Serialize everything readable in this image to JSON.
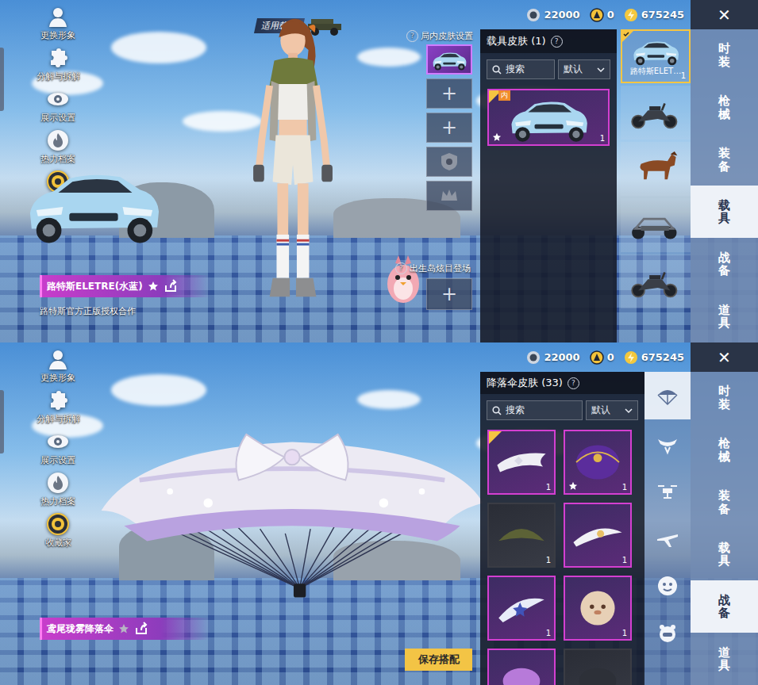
{
  "vehicle_screen": {
    "left_menu": [
      {
        "label": "更换形象"
      },
      {
        "label": "分解与拆解"
      },
      {
        "label": "展示设置"
      },
      {
        "label": "热力档案"
      },
      {
        "label": "藏家"
      }
    ],
    "applicable_vehicle": {
      "label": "适用载具"
    },
    "currency": [
      {
        "value": "22000"
      },
      {
        "value": "0"
      },
      {
        "value": "675245"
      }
    ],
    "close": "✕",
    "featured": {
      "name": "路特斯ELETRE(水蓝)",
      "subtitle": "路特斯官方正版授权合作"
    },
    "skin_slots": {
      "title": "局内皮肤设置",
      "help": "?",
      "slots": [
        {
          "kind": "car",
          "selected": true
        },
        {
          "kind": "add",
          "label": "+",
          "selected": false
        },
        {
          "kind": "add",
          "label": "+",
          "selected": false
        },
        {
          "kind": "badge",
          "selected": false
        },
        {
          "kind": "crown",
          "selected": false
        }
      ]
    },
    "entrance": {
      "title": "出生岛炫目登场",
      "help": "?",
      "add": "+"
    },
    "panel": {
      "title": "载具皮肤 (1)",
      "help": "?",
      "search": "搜索",
      "sort": "默认",
      "items": [
        {
          "tag": "内",
          "count": "1",
          "starred": true,
          "equipped": true
        }
      ]
    },
    "vehicles": [
      {
        "kind": "car",
        "label": "路特斯ELET…",
        "count": "1",
        "selected": true
      },
      {
        "kind": "motorcycle",
        "selected": false
      },
      {
        "kind": "horse",
        "selected": false
      },
      {
        "kind": "buggy",
        "selected": false
      },
      {
        "kind": "motorcycle",
        "selected": false
      }
    ],
    "tabs": [
      {
        "label": "时装",
        "selected": false
      },
      {
        "label": "枪械",
        "selected": false
      },
      {
        "label": "装备",
        "selected": false
      },
      {
        "label": "载具",
        "selected": true
      },
      {
        "label": "战备",
        "selected": false
      },
      {
        "label": "道具",
        "selected": false
      }
    ]
  },
  "parachute_screen": {
    "left_menu": [
      {
        "label": "更换形象"
      },
      {
        "label": "分解与拆解"
      },
      {
        "label": "展示设置"
      },
      {
        "label": "热力档案"
      },
      {
        "label": "收藏家"
      }
    ],
    "currency": [
      {
        "value": "22000"
      },
      {
        "value": "0"
      },
      {
        "value": "675245"
      }
    ],
    "close": "✕",
    "featured": {
      "name": "鸢尾珑雾降落伞"
    },
    "panel": {
      "title": "降落伞皮肤 (33)",
      "help": "?",
      "search": "搜索",
      "sort": "默认",
      "items": [
        {
          "kind": "white-bow",
          "count": "1",
          "starred": false,
          "equipped": true,
          "color": "#d43fd1"
        },
        {
          "kind": "purple-dome",
          "count": "1",
          "starred": true,
          "equipped": false,
          "color": "#d43fd1"
        },
        {
          "kind": "army-green",
          "count": "1",
          "starred": false,
          "equipped": false,
          "color": "#3a3c44"
        },
        {
          "kind": "white-sun",
          "count": "1",
          "starred": false,
          "equipped": false,
          "color": "#d43fd1"
        },
        {
          "kind": "star-blue",
          "count": "1",
          "starred": false,
          "equipped": false,
          "color": "#d43fd1"
        },
        {
          "kind": "plush",
          "count": "1",
          "starred": false,
          "equipped": false,
          "color": "#d43fd1"
        },
        {
          "kind": "purple-fluffy",
          "starred": false,
          "equipped": false,
          "color": "#d43fd1"
        },
        {
          "kind": "dark",
          "starred": false,
          "equipped": false,
          "color": "#3a3c44"
        }
      ]
    },
    "categories": [
      {
        "kind": "parachute",
        "selected": true
      },
      {
        "kind": "glider",
        "selected": false
      },
      {
        "kind": "drone",
        "selected": false
      },
      {
        "kind": "plane",
        "selected": false
      },
      {
        "kind": "emote",
        "selected": false
      },
      {
        "kind": "mascot",
        "selected": false
      }
    ],
    "tabs": [
      {
        "label": "时装",
        "selected": false
      },
      {
        "label": "枪械",
        "selected": false
      },
      {
        "label": "装备",
        "selected": false
      },
      {
        "label": "载具",
        "selected": false
      },
      {
        "label": "战备",
        "selected": true
      },
      {
        "label": "道具",
        "selected": false
      }
    ],
    "save_button": "保存搭配"
  }
}
